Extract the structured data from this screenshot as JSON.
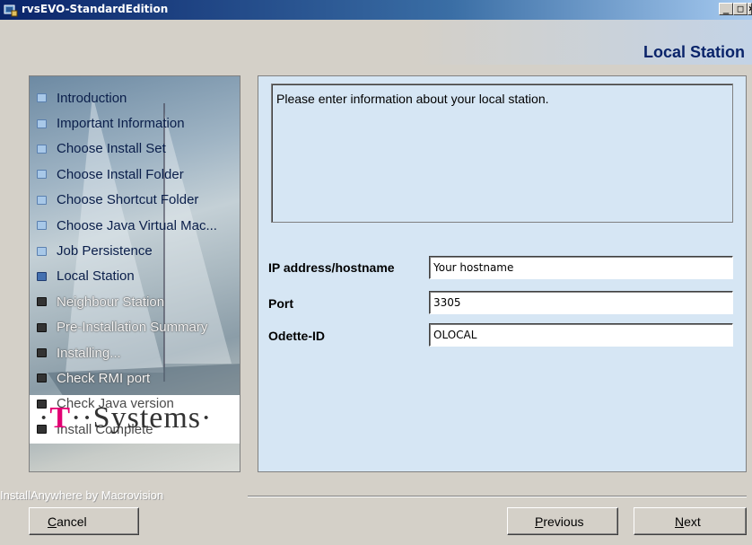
{
  "window": {
    "title": "rvsEVO-StandardEdition",
    "buttons": {
      "minimize": "_",
      "maximize": "□",
      "close": "×"
    }
  },
  "header": {
    "step_title": "Local Station"
  },
  "sidebar": {
    "steps": [
      {
        "label": "Introduction",
        "state": "done"
      },
      {
        "label": "Important Information",
        "state": "done"
      },
      {
        "label": "Choose Install Set",
        "state": "done"
      },
      {
        "label": "Choose Install Folder",
        "state": "done"
      },
      {
        "label": "Choose Shortcut Folder",
        "state": "done"
      },
      {
        "label": "Choose Java Virtual Mac...",
        "state": "done"
      },
      {
        "label": "Job Persistence",
        "state": "done"
      },
      {
        "label": "Local Station",
        "state": "current"
      },
      {
        "label": "Neighbour Station",
        "state": "todo"
      },
      {
        "label": "Pre-Installation Summary",
        "state": "todo"
      },
      {
        "label": "Installing...",
        "state": "todo"
      },
      {
        "label": "Check RMI port",
        "state": "todo"
      },
      {
        "label": "Check Java version",
        "state": "todo"
      },
      {
        "label": "Install Complete",
        "state": "todo"
      }
    ],
    "logo": {
      "prefix": "·",
      "t": "T",
      "dots": "··",
      "name": "Systems",
      "suffix": "·"
    }
  },
  "content": {
    "description": "Please enter information about your local station.",
    "fields": {
      "ip": {
        "label": "IP address/hostname",
        "value": "Your hostname"
      },
      "port": {
        "label": "Port",
        "value": "3305"
      },
      "odette": {
        "label": "Odette-ID",
        "value": "OLOCAL"
      }
    }
  },
  "footer": {
    "brand": "InstallAnywhere by Macrovision",
    "cancel": {
      "mnemonic": "C",
      "rest": "ancel"
    },
    "previous": {
      "mnemonic": "P",
      "rest": "revious"
    },
    "next": {
      "mnemonic": "N",
      "rest": "ext"
    }
  },
  "colors": {
    "title_bar": "#0a246a",
    "content_bg": "#d6e6f4",
    "logo_magenta": "#e20074"
  }
}
